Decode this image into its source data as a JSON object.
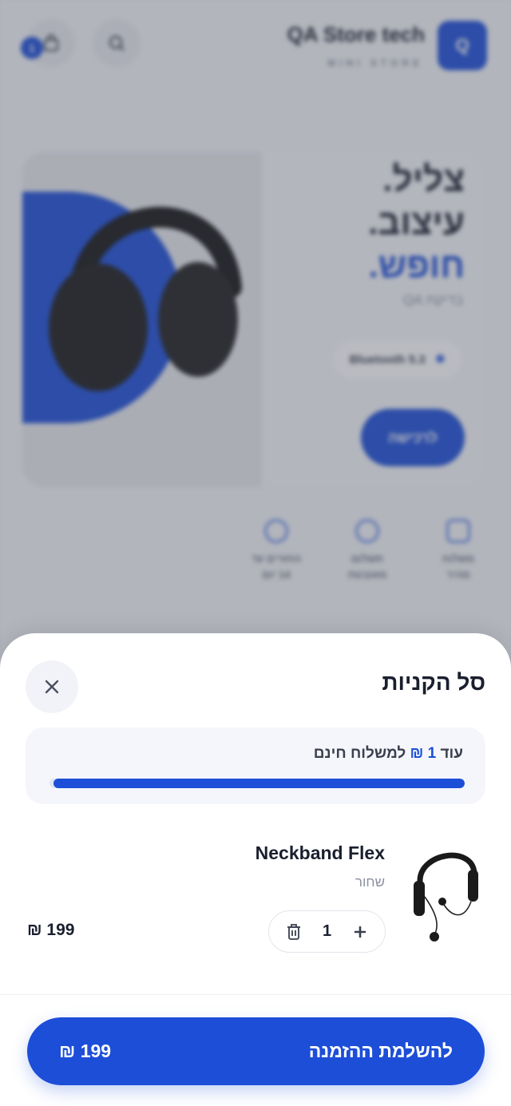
{
  "header": {
    "logo_letter": "Q",
    "store_name": "QA Store tech",
    "store_sub": "MINI STORE",
    "cart_count": "1"
  },
  "hero": {
    "headline_line1": "צליל.",
    "headline_line2": "עיצוב.",
    "headline_line3": "חופש.",
    "subtitle": "בדיקת QA",
    "chip_label": "Bluetooth 5.3",
    "cta_label": "לרכישה"
  },
  "features": [
    {
      "label": "משלוח\nמהיר"
    },
    {
      "label": "תשלום\nמאובטח"
    },
    {
      "label": "החזרים עד\n14 יום"
    }
  ],
  "cart": {
    "title": "סל הקניות",
    "shipping": {
      "prefix": "עוד",
      "amount": "1",
      "currency": "₪",
      "suffix": "למשלוח חינם",
      "progress_fraction": 0.99
    },
    "items": [
      {
        "name": "Neckband Flex",
        "variant": "שחור",
        "quantity": "1",
        "price": "199 ₪"
      }
    ],
    "checkout_label": "להשלמת ההזמנה",
    "checkout_total": "199 ₪"
  },
  "colors": {
    "accent": "#1d4ed8",
    "text": "#1a1f2e",
    "muted": "#8a90a0"
  }
}
